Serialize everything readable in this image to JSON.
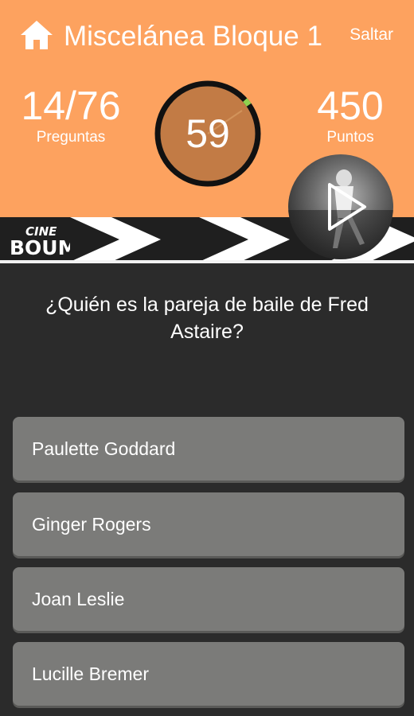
{
  "header": {
    "title": "Miscelánea Bloque 1",
    "skip_label": "Saltar",
    "home_icon": "home-icon",
    "background_color": "#fda25f"
  },
  "stats": {
    "questions_value": "14/76",
    "questions_label": "Preguntas",
    "points_value": "450",
    "points_label": "Puntos"
  },
  "timer": {
    "value": "59",
    "progress_fraction": 0.98,
    "ring_color": "#8fd14f",
    "fill_color": "#c27b45"
  },
  "brand": {
    "logo_line1": "CINE",
    "logo_line2": "BOUM"
  },
  "video": {
    "icon": "play-icon"
  },
  "question": {
    "text": "¿Quién es la pareja de baile de Fred Astaire?"
  },
  "answers": [
    {
      "label": "Paulette Goddard"
    },
    {
      "label": "Ginger Rogers"
    },
    {
      "label": "Joan Leslie"
    },
    {
      "label": "Lucille Bremer"
    }
  ]
}
